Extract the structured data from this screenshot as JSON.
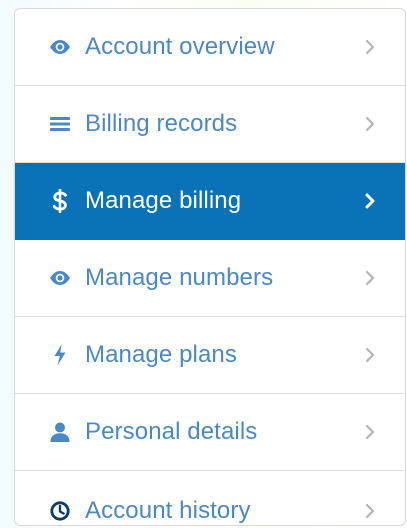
{
  "colors": {
    "accent": "#0a73b7",
    "link": "#4a89c7",
    "chevron": "#b5b5b5",
    "active_text": "#ffffff"
  },
  "menu": {
    "items": [
      {
        "label": "Account overview",
        "icon": "eye-icon",
        "active": false
      },
      {
        "label": "Billing records",
        "icon": "list-icon",
        "active": false
      },
      {
        "label": "Manage billing",
        "icon": "dollar-icon",
        "active": true
      },
      {
        "label": "Manage numbers",
        "icon": "eye-icon",
        "active": false
      },
      {
        "label": "Manage plans",
        "icon": "lightning-icon",
        "active": false
      },
      {
        "label": "Personal details",
        "icon": "user-icon",
        "active": false
      },
      {
        "label": "Account history",
        "icon": "clock-icon",
        "active": false
      }
    ]
  }
}
